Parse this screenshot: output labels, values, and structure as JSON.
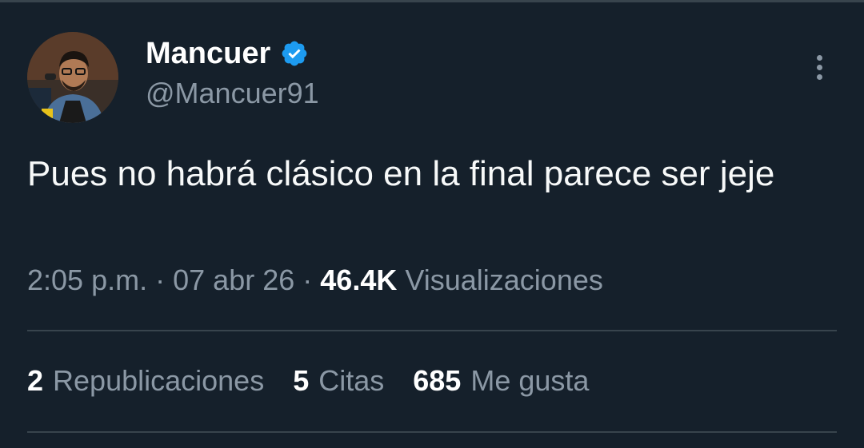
{
  "tweet": {
    "author_name": "Mancuer",
    "author_handle": "@Mancuer91",
    "text": "Pues no habrá clásico en la final parece ser jeje",
    "time": "2:05 p.m.",
    "separator": "·",
    "date": "07 abr 26",
    "views_count": "46.4K",
    "views_label": "Visualizaciones"
  },
  "stats": [
    {
      "count": "2",
      "label": "Republicaciones"
    },
    {
      "count": "5",
      "label": "Citas"
    },
    {
      "count": "685",
      "label": "Me gusta"
    }
  ],
  "icons": {
    "verified": "verified-badge-icon",
    "more": "more-options-icon"
  },
  "colors": {
    "background": "#15202b",
    "divider": "#38444d",
    "secondary_text": "#8b98a5",
    "verified_blue": "#1d9bf0"
  }
}
